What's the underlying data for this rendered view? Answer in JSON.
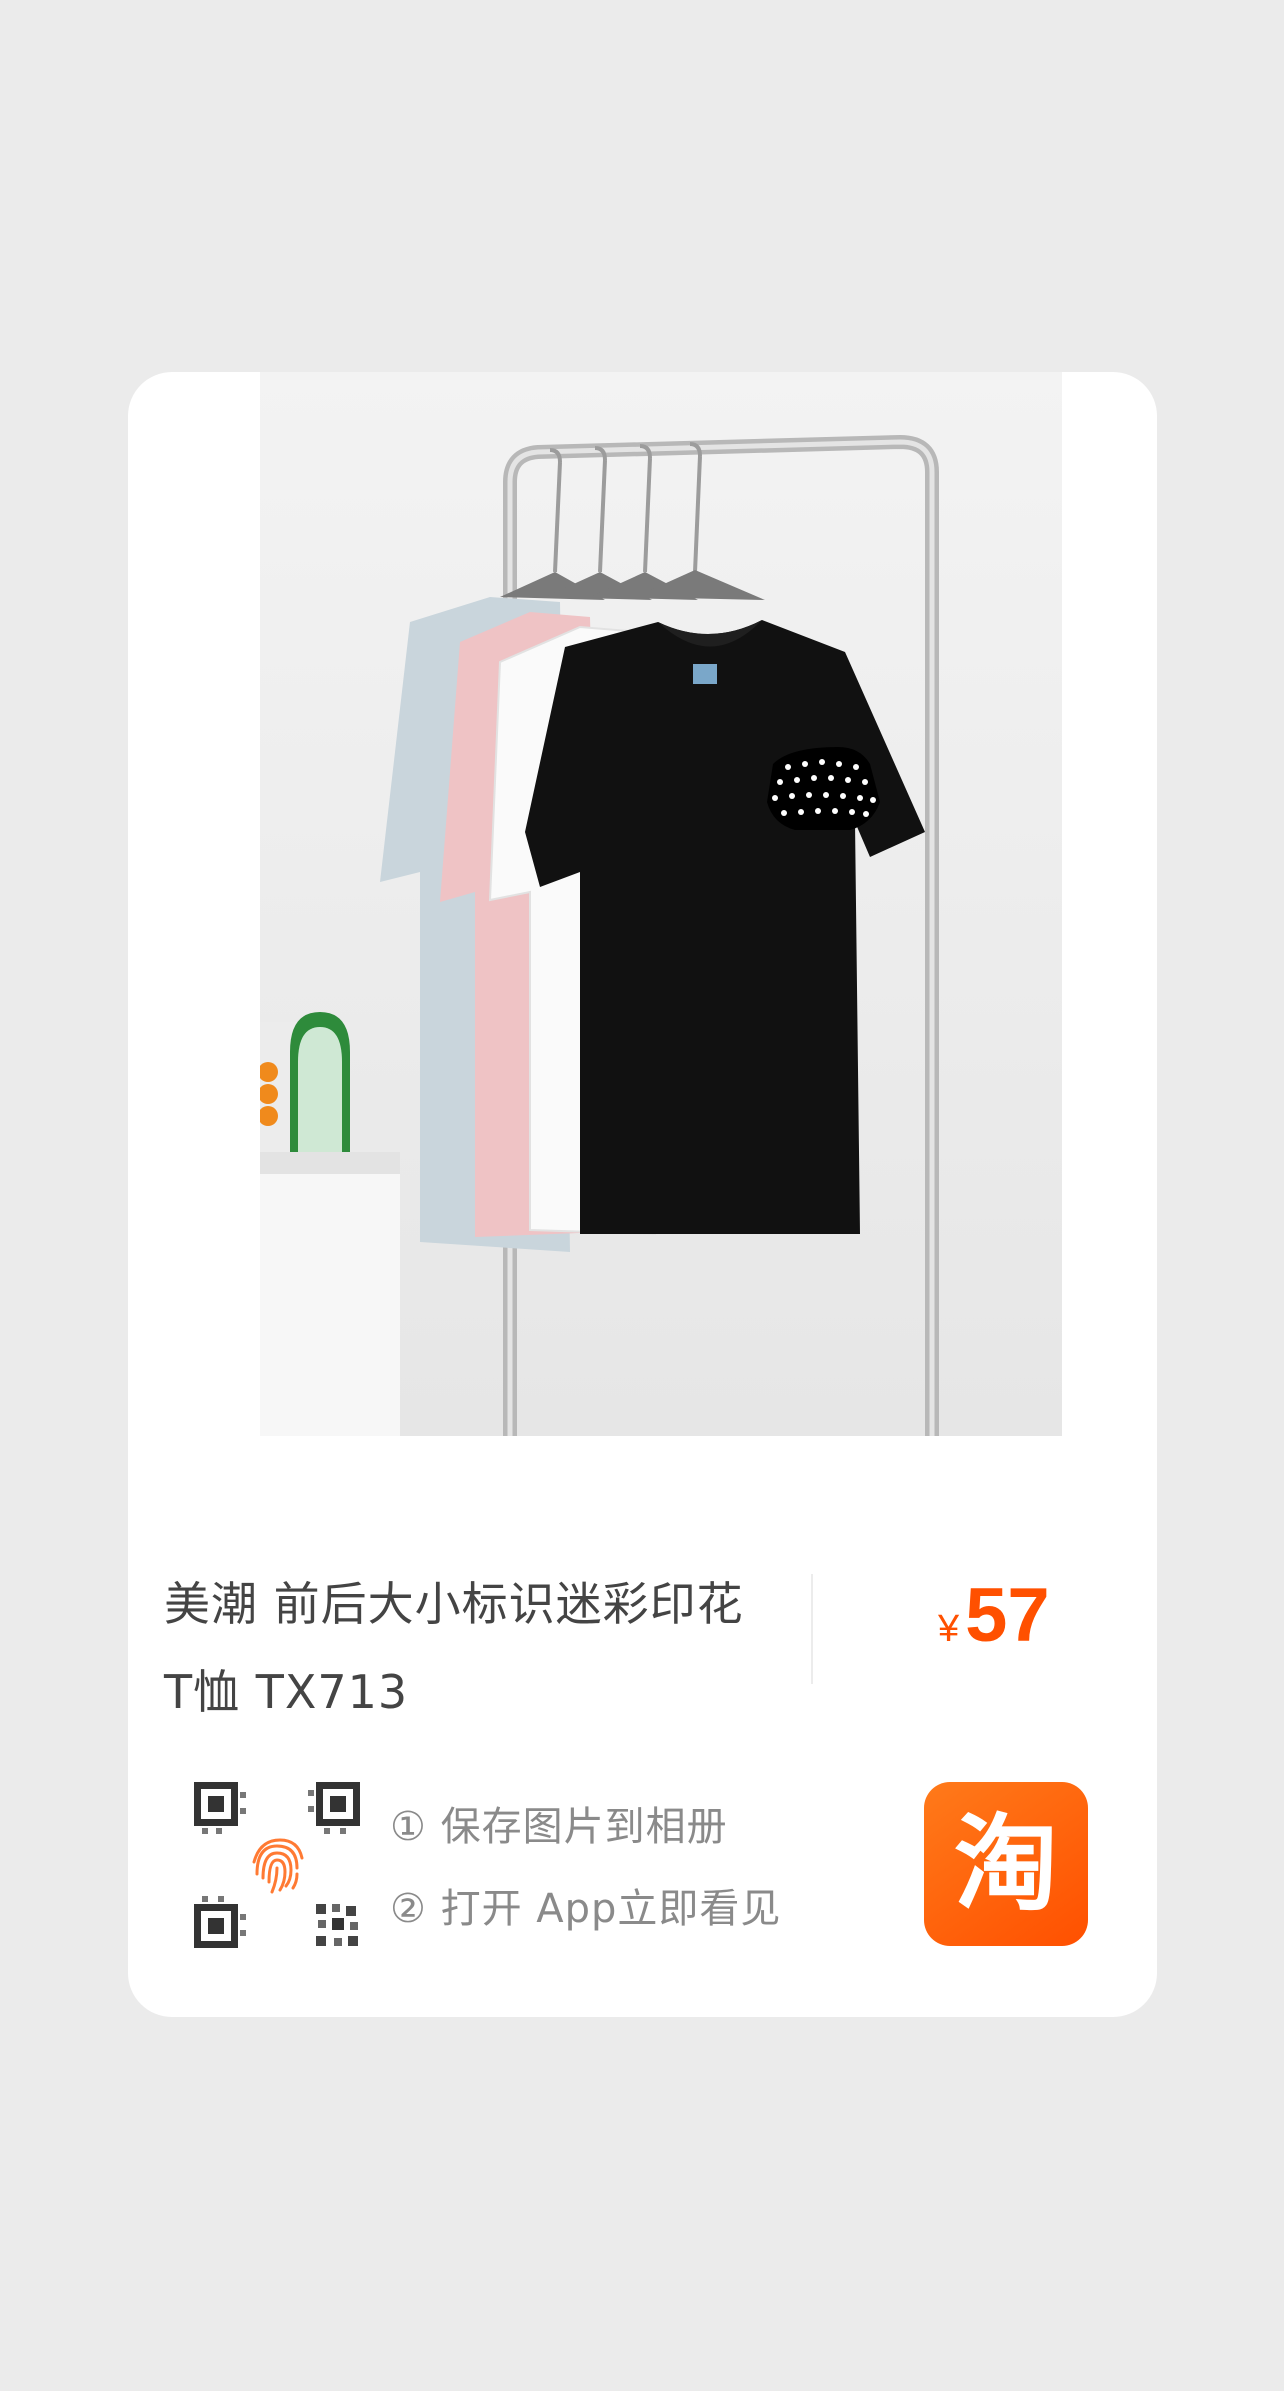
{
  "product": {
    "title": "美潮 前后大小标识迷彩印花 T恤 TX713",
    "price_currency": "¥",
    "price_value": "57"
  },
  "steps": {
    "save": "① 保存图片到相册",
    "open": "② 打开 App立即看见"
  },
  "logo": {
    "glyph": "淘"
  },
  "colors": {
    "accent": "#ff5000",
    "page_background": "#ebebeb",
    "card_background": "#ffffff"
  },
  "icons": {
    "scan": "qr-fingerprint-icon",
    "app": "taobao-logo"
  }
}
